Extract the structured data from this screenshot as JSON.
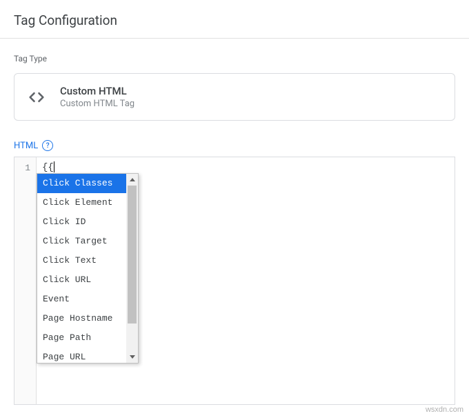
{
  "header": {
    "title": "Tag Configuration"
  },
  "tag_type": {
    "label": "Tag Type",
    "title": "Custom HTML",
    "subtitle": "Custom HTML Tag"
  },
  "html_section": {
    "label": "HTML",
    "help_symbol": "?",
    "line_number": "1",
    "code_content": "{{"
  },
  "autocomplete": {
    "items": [
      {
        "label": "Click Classes",
        "selected": true
      },
      {
        "label": "Click Element",
        "selected": false
      },
      {
        "label": "Click ID",
        "selected": false
      },
      {
        "label": "Click Target",
        "selected": false
      },
      {
        "label": "Click Text",
        "selected": false
      },
      {
        "label": "Click URL",
        "selected": false
      },
      {
        "label": "Event",
        "selected": false
      },
      {
        "label": "Page Hostname",
        "selected": false
      },
      {
        "label": "Page Path",
        "selected": false
      },
      {
        "label": "Page URL",
        "selected": false
      }
    ]
  },
  "watermark": "wsxdn.com"
}
